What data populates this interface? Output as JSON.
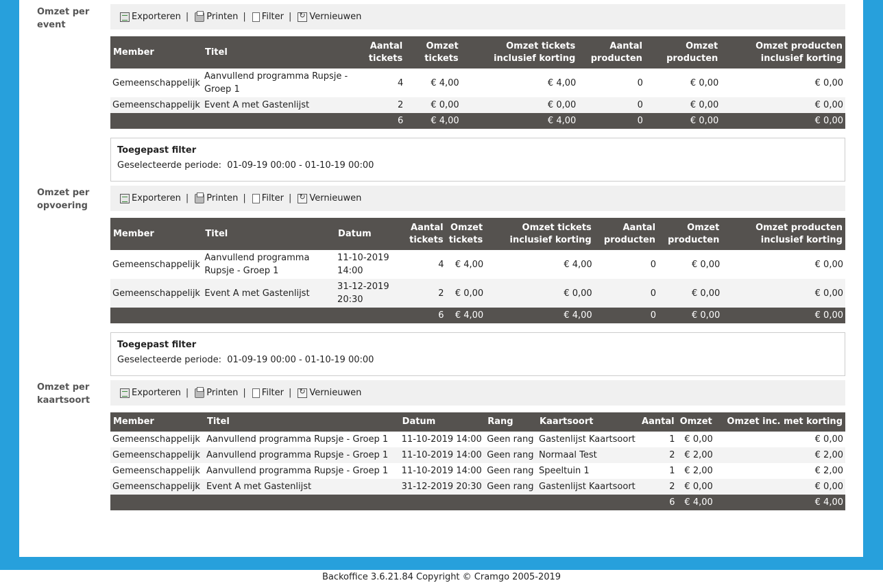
{
  "toolbar": {
    "export": "Exporteren",
    "print": "Printen",
    "filter": "Filter",
    "refresh": "Vernieuwen",
    "separator": "|"
  },
  "filter_box": {
    "title": "Toegepast filter",
    "period_label": "Geselecteerde periode:",
    "period_value": "01-09-19 00:00 - 01-10-19 00:00"
  },
  "event_section": {
    "label": "Omzet per event",
    "columns": [
      "Member",
      "Titel",
      "Aantal tickets",
      "Omzet tickets",
      "Omzet tickets inclusief korting",
      "Aantal producten",
      "Omzet producten",
      "Omzet producten inclusief korting"
    ],
    "rows": [
      [
        "Gemeenschappelijk",
        "Aanvullend programma Rupsje - Groep 1",
        "4",
        "€ 4,00",
        "€ 4,00",
        "0",
        "€ 0,00",
        "€ 0,00"
      ],
      [
        "Gemeenschappelijk",
        "Event A met Gastenlijst",
        "2",
        "€ 0,00",
        "€ 0,00",
        "0",
        "€ 0,00",
        "€ 0,00"
      ]
    ],
    "footer": [
      "",
      "",
      "6",
      "€ 4,00",
      "€ 4,00",
      "0",
      "€ 0,00",
      "€ 0,00"
    ]
  },
  "performance_section": {
    "label": "Omzet per opvoering",
    "columns": [
      "Member",
      "Titel",
      "Datum",
      "Aantal tickets",
      "Omzet tickets",
      "Omzet tickets inclusief korting",
      "Aantal producten",
      "Omzet producten",
      "Omzet producten inclusief korting"
    ],
    "rows": [
      [
        "Gemeenschappelijk",
        "Aanvullend programma Rupsje - Groep 1",
        "11-10-2019 14:00",
        "4",
        "€ 4,00",
        "€ 4,00",
        "0",
        "€ 0,00",
        "€ 0,00"
      ],
      [
        "Gemeenschappelijk",
        "Event A met Gastenlijst",
        "31-12-2019 20:30",
        "2",
        "€ 0,00",
        "€ 0,00",
        "0",
        "€ 0,00",
        "€ 0,00"
      ]
    ],
    "footer": [
      "",
      "",
      "",
      "6",
      "€ 4,00",
      "€ 4,00",
      "0",
      "€ 0,00",
      "€ 0,00"
    ]
  },
  "cardtype_section": {
    "label": "Omzet per kaartsoort",
    "columns": [
      "Member",
      "Titel",
      "Datum",
      "Rang",
      "Kaartsoort",
      "Aantal",
      "Omzet",
      "Omzet inc. met korting"
    ],
    "rows": [
      [
        "Gemeenschappelijk",
        "Aanvullend programma Rupsje - Groep 1",
        "11-10-2019 14:00",
        "Geen rang",
        "Gastenlijst Kaartsoort",
        "1",
        "€ 0,00",
        "€ 0,00"
      ],
      [
        "Gemeenschappelijk",
        "Aanvullend programma Rupsje - Groep 1",
        "11-10-2019 14:00",
        "Geen rang",
        "Normaal Test",
        "2",
        "€ 2,00",
        "€ 2,00"
      ],
      [
        "Gemeenschappelijk",
        "Aanvullend programma Rupsje - Groep 1",
        "11-10-2019 14:00",
        "Geen rang",
        "Speeltuin 1",
        "1",
        "€ 2,00",
        "€ 2,00"
      ],
      [
        "Gemeenschappelijk",
        "Event A met Gastenlijst",
        "31-12-2019 20:30",
        "Geen rang",
        "Gastenlijst Kaartsoort",
        "2",
        "€ 0,00",
        "€ 0,00"
      ]
    ],
    "footer": [
      "",
      "",
      "",
      "",
      "",
      "6",
      "€ 4,00",
      "€ 4,00"
    ]
  },
  "footer": {
    "text": "Backoffice 3.6.21.84 Copyright © Cramgo 2005-2019"
  },
  "colors": {
    "frame": "#27a0dc",
    "header": "#55524f",
    "toolbar": "#f0f0f0"
  }
}
